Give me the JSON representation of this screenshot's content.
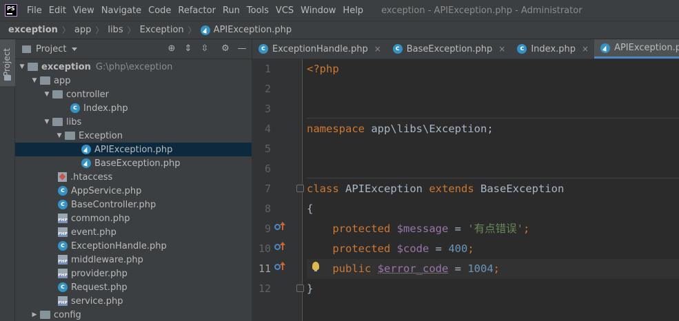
{
  "menubar": {
    "logo_text": "PS",
    "items": [
      "File",
      "Edit",
      "View",
      "Navigate",
      "Code",
      "Refactor",
      "Run",
      "Tools",
      "VCS",
      "Window",
      "Help"
    ],
    "window_title": "exception - APIException.php - Administrator"
  },
  "breadcrumb": {
    "items": [
      "exception",
      "app",
      "libs",
      "Exception",
      "APIException.php"
    ]
  },
  "sidebar_stripe": {
    "label": "Project"
  },
  "project_panel": {
    "title": "Project",
    "tools": [
      "locate-icon",
      "expand-all-icon",
      "collapse-all-icon",
      "gear-icon",
      "minimize-icon"
    ],
    "tree": [
      {
        "label": "exception",
        "path": "G:\\php\\exception",
        "type": "folder"
      },
      {
        "label": "app",
        "type": "folder"
      },
      {
        "label": "controller",
        "type": "folder"
      },
      {
        "label": "Index.php",
        "type": "php-class"
      },
      {
        "label": "libs",
        "type": "folder"
      },
      {
        "label": "Exception",
        "type": "folder"
      },
      {
        "label": "APIException.php",
        "type": "php-exception",
        "selected": true
      },
      {
        "label": "BaseException.php",
        "type": "php-exception"
      },
      {
        "label": ".htaccess",
        "type": "htaccess"
      },
      {
        "label": "AppService.php",
        "type": "php-class"
      },
      {
        "label": "BaseController.php",
        "type": "php-class"
      },
      {
        "label": "common.php",
        "type": "php-file"
      },
      {
        "label": "event.php",
        "type": "php-file"
      },
      {
        "label": "ExceptionHandle.php",
        "type": "php-class"
      },
      {
        "label": "middleware.php",
        "type": "php-file"
      },
      {
        "label": "provider.php",
        "type": "php-file"
      },
      {
        "label": "Request.php",
        "type": "php-class"
      },
      {
        "label": "service.php",
        "type": "php-file"
      },
      {
        "label": "config",
        "type": "folder"
      }
    ]
  },
  "tabs": [
    {
      "label": "ExceptionHandle.php",
      "close": "×",
      "active": false
    },
    {
      "label": "BaseException.php",
      "close": "×",
      "active": false
    },
    {
      "label": "Index.php",
      "close": "×",
      "active": false
    },
    {
      "label": "APIException.php",
      "close": "×",
      "active": true
    }
  ],
  "editor": {
    "line_numbers": [
      "1",
      "2",
      "3",
      "4",
      "5",
      "6",
      "7",
      "8",
      "9",
      "10",
      "11",
      "12"
    ],
    "current_line": "11",
    "code": {
      "l1": "<?php",
      "l4_kw": "namespace",
      "l4_ns": "app\\libs\\Exception;",
      "l7_kw1": "class",
      "l7_name": "APIException",
      "l7_kw2": "extends",
      "l7_parent": "BaseException",
      "l8": "{",
      "l9_kw": "protected",
      "l9_var": "$message",
      "l9_eq": " = ",
      "l9_str": "'有点错误'",
      "l9_end": ";",
      "l10_kw": "protected",
      "l10_var": "$code",
      "l10_eq": " = ",
      "l10_num": "400",
      "l10_end": ";",
      "l11_kw": "public",
      "l11_var": "$error_code",
      "l11_eq": " = ",
      "l11_num": "1004",
      "l11_end": ";",
      "l12": "}"
    }
  },
  "colors": {
    "keyword": "#cc7832",
    "variable": "#9876aa",
    "string": "#6a8759",
    "number": "#6897bb",
    "identifier": "#a9b7c6",
    "selection": "#0d293e",
    "active_tab_underline": "#4a88c7"
  }
}
